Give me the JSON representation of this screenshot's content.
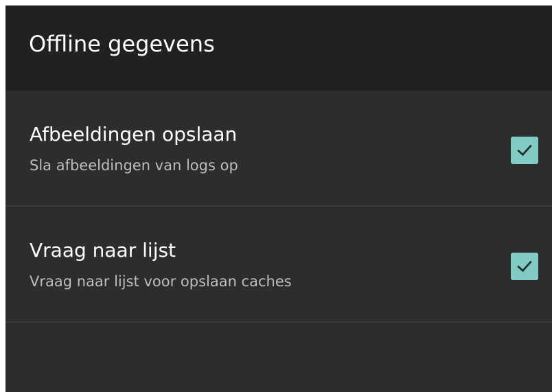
{
  "app_bar": {
    "title": "Offline gegevens"
  },
  "preferences": [
    {
      "title": "Afbeeldingen opslaan",
      "summary": "Sla afbeeldingen van logs op",
      "checked": true
    },
    {
      "title": "Vraag naar lijst",
      "summary": "Vraag naar lijst voor opslaan caches",
      "checked": true
    }
  ],
  "colors": {
    "app_bar_background": "#212121",
    "screen_background": "#2d2d2d",
    "divider": "#3d3d3d",
    "accent_checkbox": "#80cbc4",
    "title_text": "#ffffff",
    "summary_text": "#bdbdbd"
  },
  "icons": {
    "checkbox_checked": "check-icon"
  }
}
